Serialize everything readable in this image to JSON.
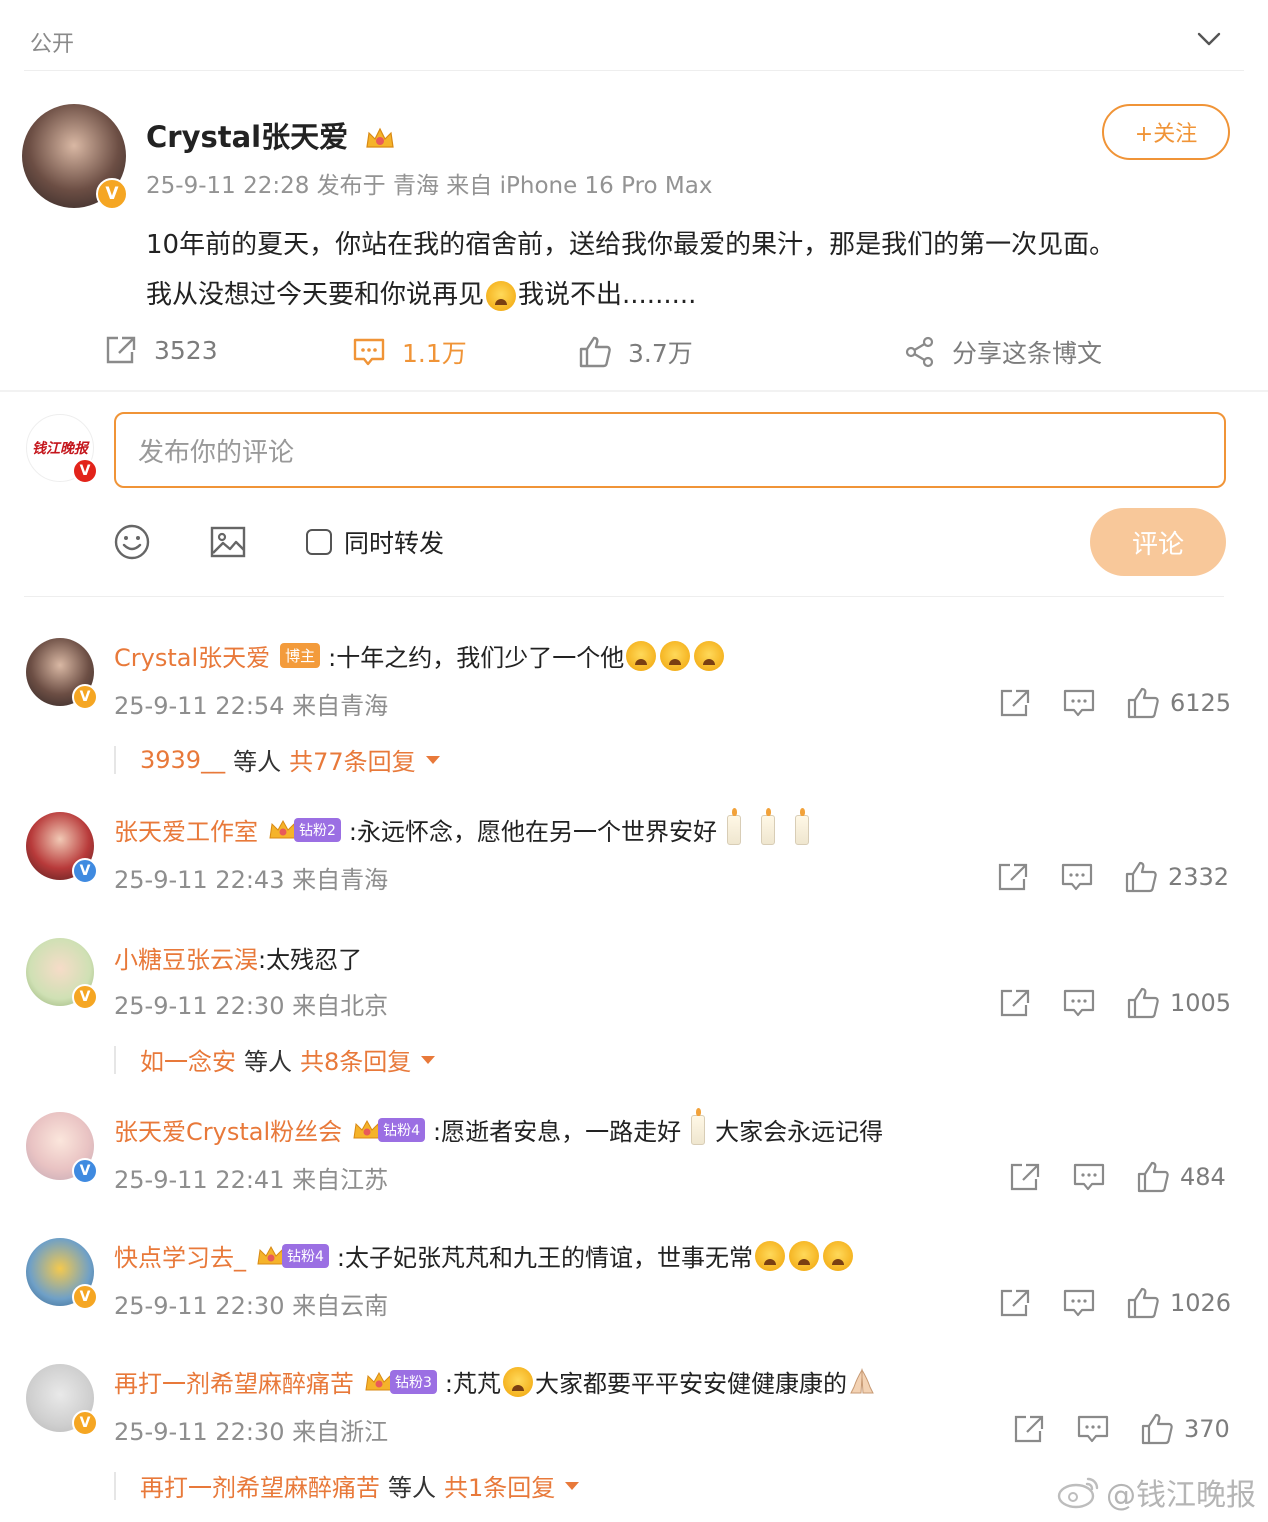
{
  "header": {
    "visibility": "公开"
  },
  "post": {
    "author": "Crystal张天爱",
    "meta": "25-9-11 22:28 发布于 青海 来自 iPhone 16 Pro Max",
    "text_line1": "10年前的夏天，你站在我的宿舍前，送给我你最爱的果汁，那是我们的第一次见面。",
    "text_line2a": "我从没想过今天要和你说再见",
    "text_line2b": "我说不出.........",
    "follow_label": "+关注",
    "repost_count": "3523",
    "comment_count": "1.1万",
    "like_count": "3.7万",
    "share_label": "分享这条博文"
  },
  "composer": {
    "placeholder": "发布你的评论",
    "also_repost_label": "同时转发",
    "submit_label": "评论"
  },
  "comments": [
    {
      "name": "Crystal张天爱",
      "badge": "博主",
      "text": ":十年之约，我们少了一个他",
      "meta": "25-9-11 22:54 来自青海",
      "likes": "6125",
      "reply_user": "3939__",
      "reply_mid": "等人",
      "reply_total": "共77条回复"
    },
    {
      "name": "张天爱工作室",
      "badge": "钻粉2",
      "text": ":永远怀念，愿他在另一个世界安好",
      "meta": "25-9-11 22:43 来自青海",
      "likes": "2332"
    },
    {
      "name": "小糖豆张云淏",
      "text": ":太残忍了",
      "meta": "25-9-11 22:30 来自北京",
      "likes": "1005",
      "reply_user": "如一念安",
      "reply_mid": "等人",
      "reply_total": "共8条回复"
    },
    {
      "name": "张天爱Crystal粉丝会",
      "badge": "钻粉4",
      "text": ":愿逝者安息，一路走好",
      "text2": "大家会永远记得",
      "meta": "25-9-11 22:41 来自江苏",
      "likes": "484"
    },
    {
      "name": "快点学习去_",
      "badge": "钻粉4",
      "text": ":太子妃张芃芃和九王的情谊，世事无常",
      "meta": "25-9-11 22:30 来自云南",
      "likes": "1026"
    },
    {
      "name": "再打一剂希望麻醉痛苦",
      "badge": "钻粉3",
      "text": ":芃芃",
      "text2": "大家都要平平安安健健康康的",
      "meta": "25-9-11 22:30 来自浙江",
      "likes": "370",
      "reply_user": "再打一剂希望麻醉痛苦",
      "reply_mid": "等人",
      "reply_total": "共1条回复"
    }
  ],
  "watermark": "@钱江晚报",
  "avatar_logo_text": "钱江晚报",
  "colors": {
    "accent": "#f09437",
    "name": "#e8793a",
    "verified_orange": "#f5a623",
    "verified_blue": "#3f8ae0",
    "verified_red": "#e2231a"
  },
  "icons": [
    "chevron-down-icon",
    "crown-icon",
    "repost-icon",
    "comment-icon",
    "like-icon",
    "share-icon",
    "emoji-icon",
    "image-icon",
    "crying-emoji",
    "candle-emoji",
    "pray-emoji",
    "weibo-logo-icon"
  ]
}
